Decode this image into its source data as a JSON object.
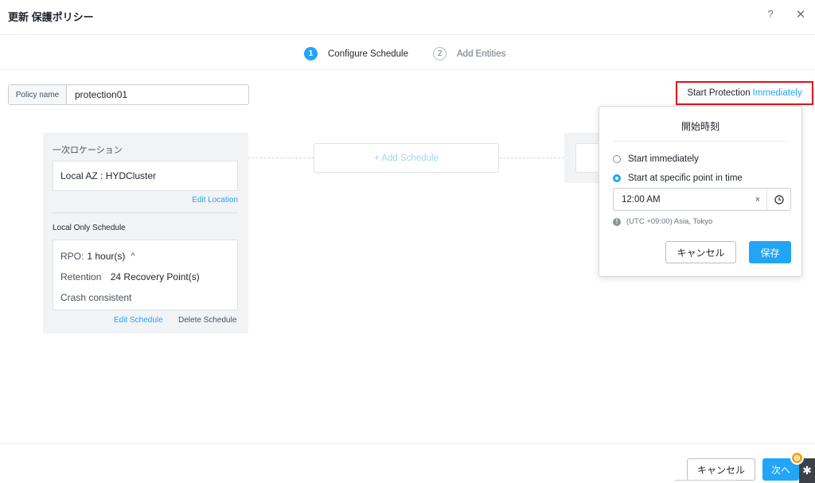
{
  "dialog": {
    "title": "更新 保護ポリシー",
    "help_label": "?",
    "close_label": "✕"
  },
  "wizard": {
    "steps": [
      {
        "number": "1",
        "label": "Configure Schedule",
        "state": "active"
      },
      {
        "number": "2",
        "label": "Add Entities",
        "state": "inactive"
      }
    ]
  },
  "policy": {
    "label": "Policy name",
    "value": "protection01"
  },
  "start_protection": {
    "label": "Start Protection",
    "value": "Immediately"
  },
  "primary_location": {
    "heading": "一次ロケーション",
    "location": "Local AZ : HYDCluster",
    "edit_location_label": "Edit Location",
    "schedule_heading": "Local Only Schedule",
    "rpo_key": "RPO:",
    "rpo_value": "1 hour(s)",
    "rpo_toggle": "^",
    "retention_key": "Retention",
    "retention_value": "24 Recovery Point(s)",
    "consistency": "Crash consistent",
    "edit_schedule_label": "Edit Schedule",
    "delete_schedule_label": "Delete Schedule"
  },
  "add_schedule": {
    "label": "+ Add Schedule"
  },
  "start_time_popover": {
    "title": "開始時刻",
    "options": [
      {
        "label": "Start immediately",
        "checked": false
      },
      {
        "label": "Start at specific point in time",
        "checked": true
      }
    ],
    "time_value": "12:00 AM",
    "clear_label": "×",
    "timezone": "(UTC +09:00) Asia, Tokyo",
    "info_glyph": "!",
    "cancel_label": "キャンセル",
    "save_label": "保存"
  },
  "footer": {
    "cancel_label": "キャンセル",
    "next_label": "次へ",
    "badge_glyph": "⊕",
    "side_tab_glyph": "✱"
  },
  "colors": {
    "accent": "#22a5f7",
    "highlight_border": "#e3101b",
    "panel_bg": "#f1f3f5",
    "badge": "#f0a21b"
  },
  "icons": [
    "help-icon",
    "close-icon",
    "chevron-up-icon",
    "clear-icon",
    "clock-icon",
    "info-icon",
    "notification-badge-icon",
    "asterisk-icon"
  ]
}
